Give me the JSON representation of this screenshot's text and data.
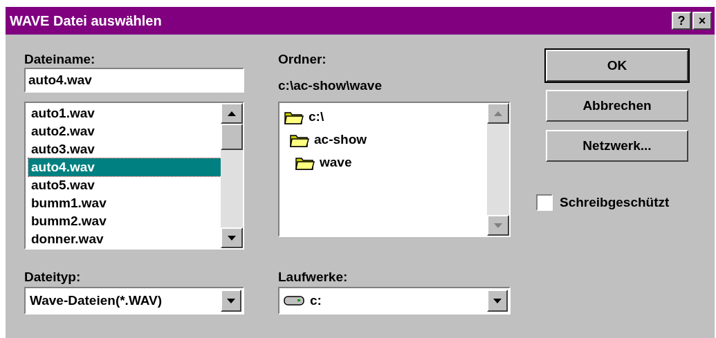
{
  "window": {
    "title": "WAVE Datei auswählen",
    "title_buttons": [
      "?",
      "×"
    ]
  },
  "filename": {
    "label": "Dateiname:",
    "value": "auto4.wav"
  },
  "files": [
    {
      "name": "auto1.wav",
      "selected": false
    },
    {
      "name": "auto2.wav",
      "selected": false
    },
    {
      "name": "auto3.wav",
      "selected": false
    },
    {
      "name": "auto4.wav",
      "selected": true
    },
    {
      "name": "auto5.wav",
      "selected": false
    },
    {
      "name": "bumm1.wav",
      "selected": false
    },
    {
      "name": "bumm2.wav",
      "selected": false
    },
    {
      "name": "donner.wav",
      "selected": false
    }
  ],
  "folder": {
    "label": "Ordner:",
    "path": "c:\\ac-show\\wave"
  },
  "folders": [
    {
      "name": "c:\\",
      "children": [
        {
          "name": "ac-show",
          "children": [
            {
              "name": "wave"
            }
          ]
        }
      ]
    }
  ],
  "filetype": {
    "label": "Dateityp:",
    "value": "Wave-Dateien(*.WAV)"
  },
  "drives": {
    "label": "Laufwerke:",
    "value": "c:"
  },
  "buttons": [
    "OK",
    "Abbrechen",
    "Netzwerk..."
  ],
  "readonly": {
    "label": "Schreibgeschützt",
    "checked": false
  }
}
